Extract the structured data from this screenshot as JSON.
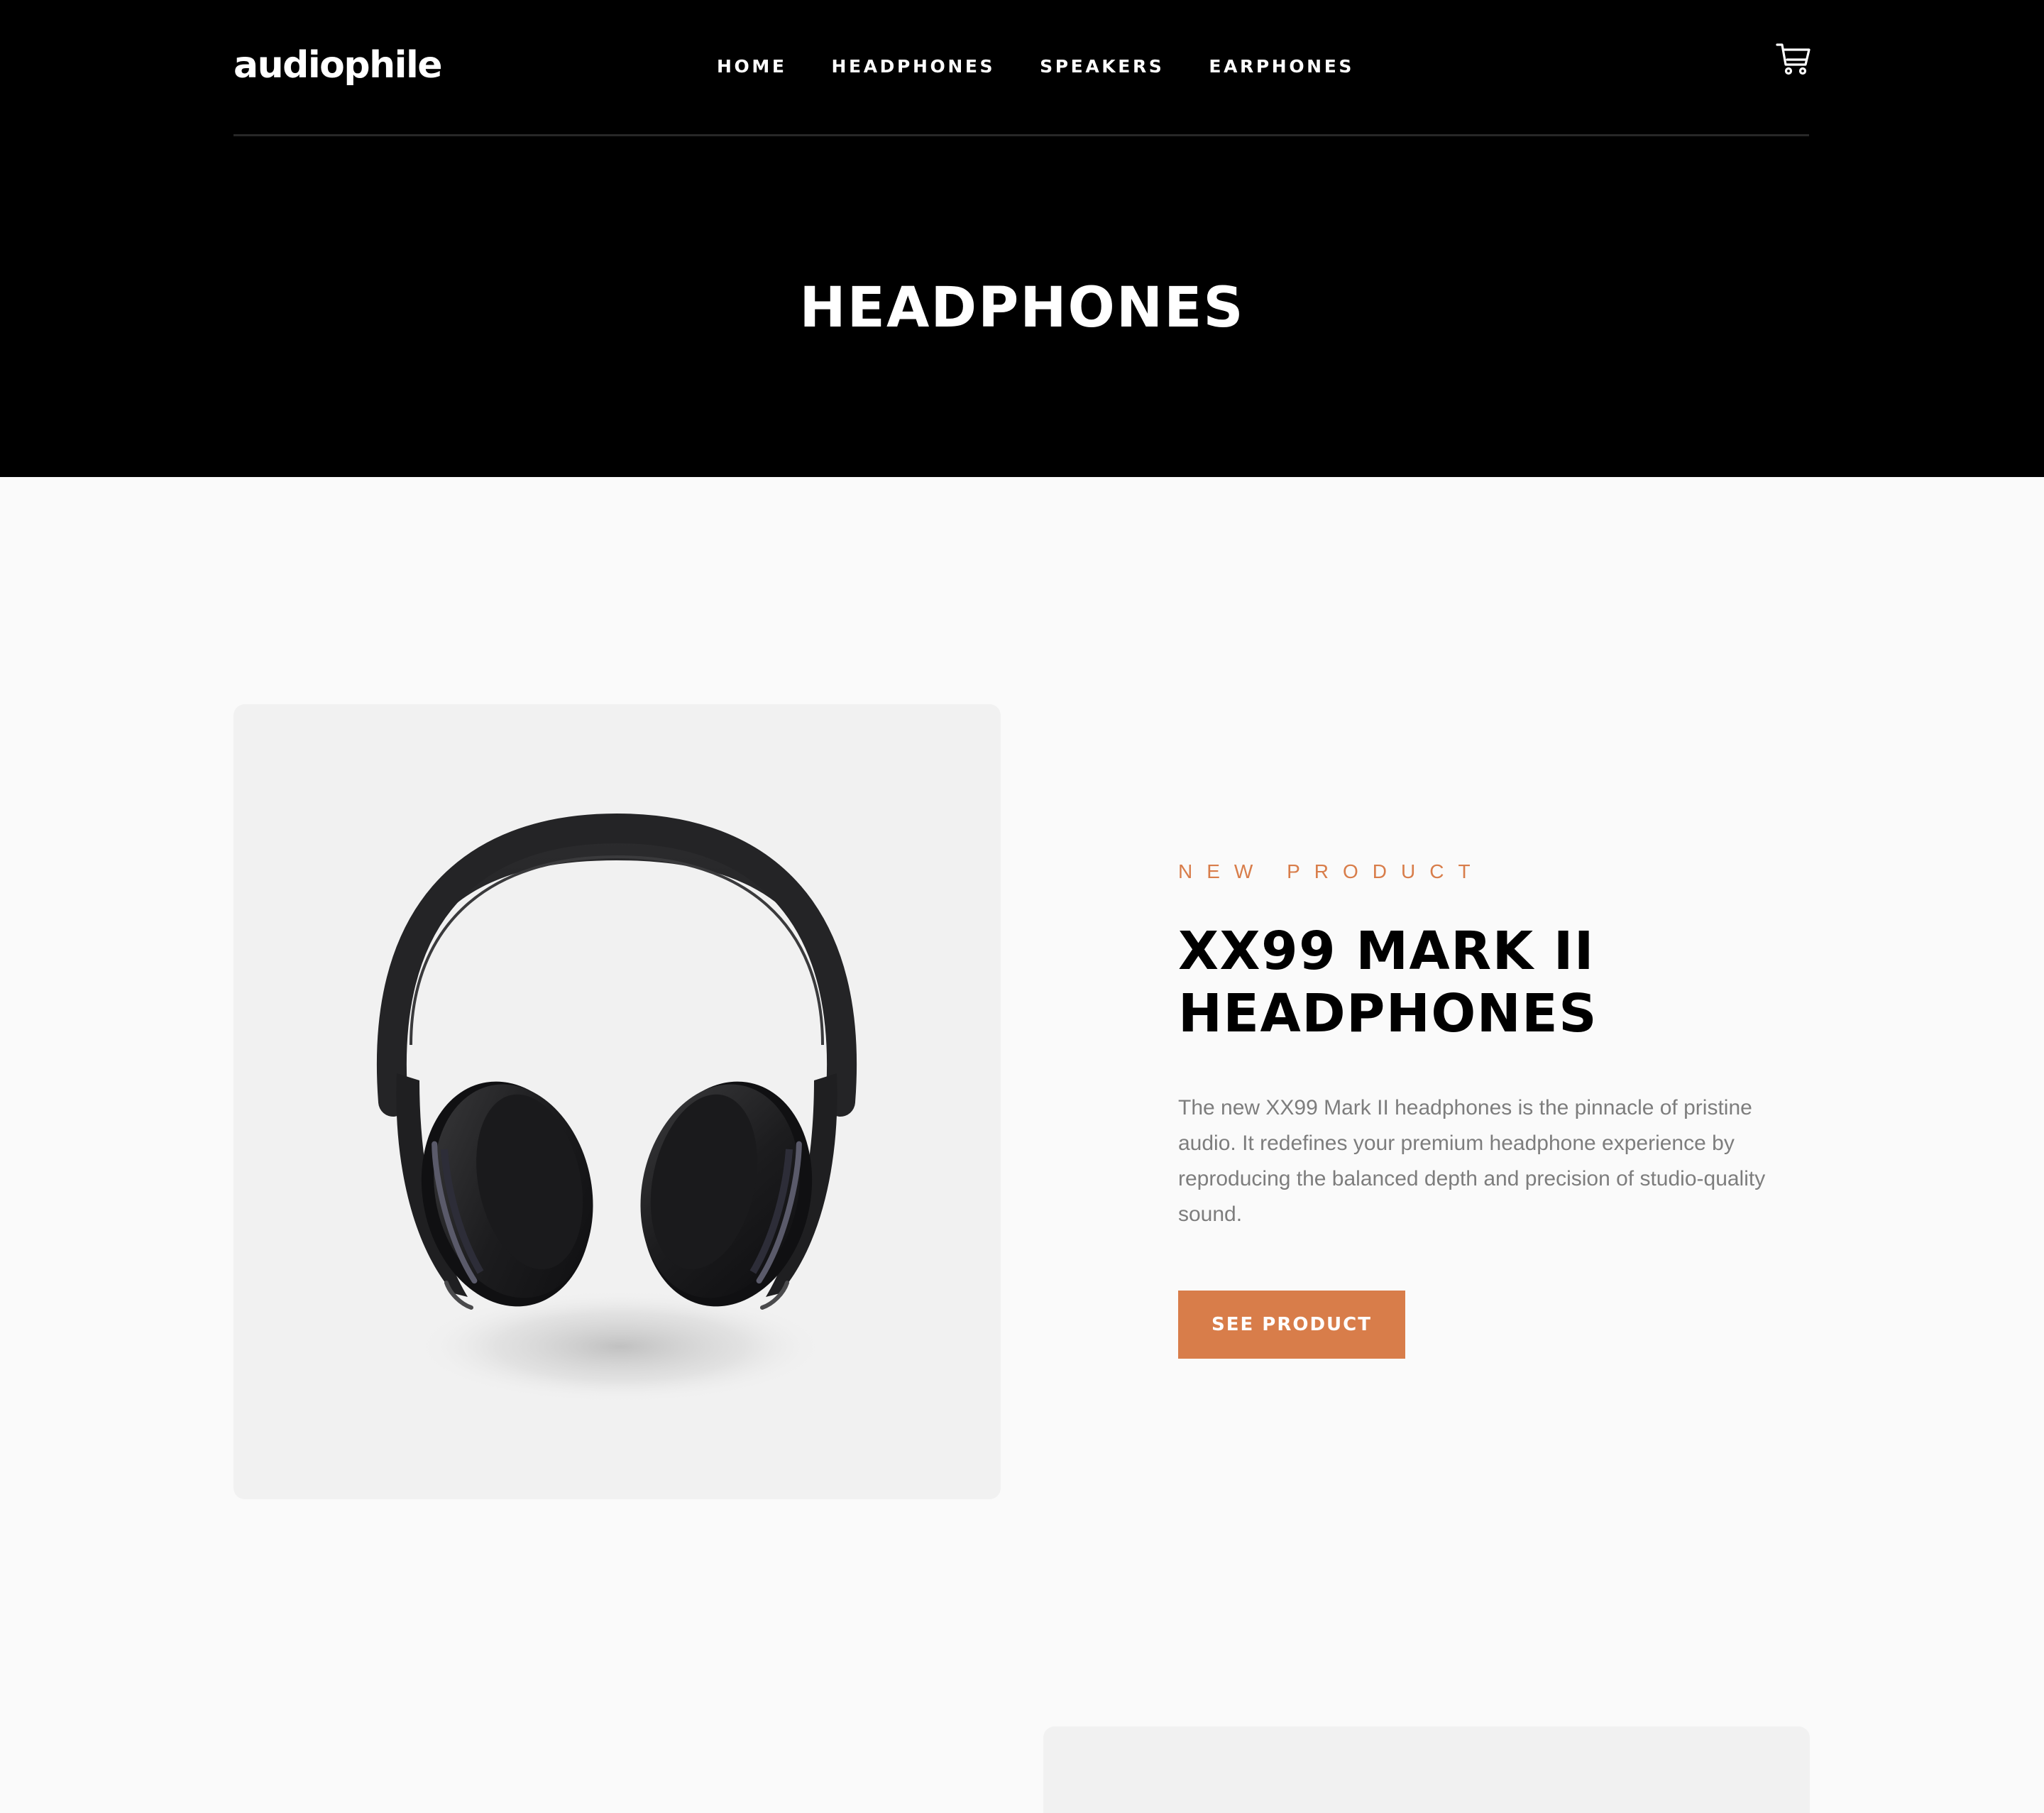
{
  "header": {
    "logo": "audiophile",
    "nav": [
      {
        "label": "HOME"
      },
      {
        "label": "HEADPHONES"
      },
      {
        "label": "SPEAKERS"
      },
      {
        "label": "EARPHONES"
      }
    ],
    "cart_icon": "cart-icon"
  },
  "hero": {
    "title": "HEADPHONES"
  },
  "products": [
    {
      "overline": "NEW PRODUCT",
      "title_line1": "XX99 MARK II",
      "title_line2": "HEADPHONES",
      "description": "The new XX99 Mark II headphones is the pinnacle of pristine audio. It redefines your premium headphone experience by reproducing the balanced depth and precision of studio-quality sound.",
      "button_label": "SEE PRODUCT",
      "image": "headphones-image"
    }
  ],
  "colors": {
    "accent": "#d87d4a",
    "header_bg": "#000000",
    "page_bg": "#fafafa",
    "card_bg": "#f1f1f1",
    "body_text": "#7d7d7d"
  }
}
